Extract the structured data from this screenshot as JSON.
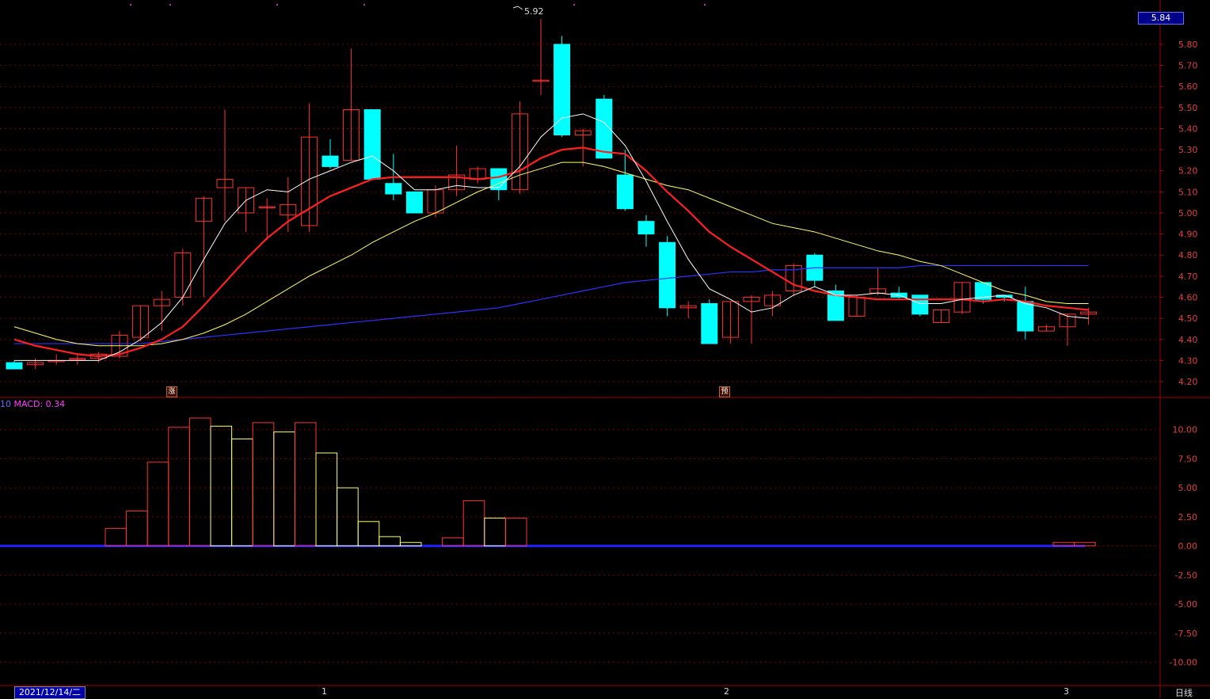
{
  "window": {
    "period": "日线",
    "date": "2021/12/14/二"
  },
  "price_panel": {
    "current_price": "5.84",
    "peak_label": "5.92",
    "axis_ticks": [
      "5.80",
      "5.70",
      "5.60",
      "5.50",
      "5.40",
      "5.30",
      "5.20",
      "5.10",
      "5.00",
      "4.90",
      "4.80",
      "4.70",
      "4.60",
      "4.50",
      "4.40",
      "4.30",
      "4.20"
    ],
    "tags": [
      "涨",
      "预"
    ]
  },
  "macd_panel": {
    "prefix": "10",
    "name": "MACD: 0.34",
    "axis_ticks": [
      "10.00",
      "7.50",
      "5.00",
      "2.50",
      "0.00",
      "-2.50",
      "-5.00",
      "-7.50",
      "-10.00"
    ]
  },
  "x_axis": {
    "months": [
      "1",
      "2",
      "3"
    ]
  },
  "colors": {
    "up": "#ff3232",
    "down": "#00ffff",
    "ma5": "#ffffff",
    "ma10": "#ff2020",
    "ma20": "#ffff60",
    "ma60": "#3030ff",
    "grid": "#800000"
  },
  "chart_data": {
    "type": "candlestick",
    "ohlc": [
      [
        4.29,
        4.3,
        4.26,
        4.26
      ],
      [
        4.28,
        4.31,
        4.26,
        4.29
      ],
      [
        4.3,
        4.33,
        4.28,
        4.3
      ],
      [
        4.31,
        4.33,
        4.28,
        4.31
      ],
      [
        4.31,
        4.34,
        4.29,
        4.33
      ],
      [
        4.32,
        4.44,
        4.31,
        4.42
      ],
      [
        4.41,
        4.56,
        4.39,
        4.56
      ],
      [
        4.56,
        4.63,
        4.44,
        4.59
      ],
      [
        4.6,
        4.83,
        4.56,
        4.81
      ],
      [
        4.96,
        5.08,
        4.6,
        5.07
      ],
      [
        5.12,
        5.49,
        4.96,
        5.16
      ],
      [
        5.0,
        5.12,
        4.91,
        5.12
      ],
      [
        5.03,
        5.07,
        4.87,
        5.03
      ],
      [
        4.99,
        5.17,
        4.91,
        5.04
      ],
      [
        4.94,
        5.52,
        4.91,
        5.36
      ],
      [
        5.27,
        5.35,
        5.21,
        5.22
      ],
      [
        5.25,
        5.78,
        5.25,
        5.49
      ],
      [
        5.49,
        5.49,
        5.16,
        5.16
      ],
      [
        5.14,
        5.28,
        5.06,
        5.09
      ],
      [
        5.1,
        5.1,
        5.0,
        5.0
      ],
      [
        5.0,
        5.13,
        4.98,
        5.11
      ],
      [
        5.11,
        5.32,
        5.08,
        5.18
      ],
      [
        5.16,
        5.22,
        5.14,
        5.21
      ],
      [
        5.21,
        5.21,
        5.06,
        5.11
      ],
      [
        5.11,
        5.53,
        5.09,
        5.47
      ],
      [
        5.63,
        5.92,
        5.56,
        5.63
      ],
      [
        5.8,
        5.84,
        5.36,
        5.37
      ],
      [
        5.37,
        5.4,
        5.22,
        5.39
      ],
      [
        5.54,
        5.56,
        5.26,
        5.26
      ],
      [
        5.18,
        5.3,
        5.01,
        5.02
      ],
      [
        4.96,
        4.99,
        4.84,
        4.9
      ],
      [
        4.86,
        4.89,
        4.51,
        4.55
      ],
      [
        4.55,
        4.58,
        4.5,
        4.56
      ],
      [
        4.57,
        4.59,
        4.38,
        4.38
      ],
      [
        4.41,
        4.58,
        4.38,
        4.58
      ],
      [
        4.58,
        4.61,
        4.38,
        4.6
      ],
      [
        4.56,
        4.63,
        4.51,
        4.61
      ],
      [
        4.63,
        4.76,
        4.61,
        4.75
      ],
      [
        4.8,
        4.81,
        4.65,
        4.68
      ],
      [
        4.63,
        4.66,
        4.49,
        4.49
      ],
      [
        4.51,
        4.61,
        4.51,
        4.6
      ],
      [
        4.62,
        4.74,
        4.61,
        4.64
      ],
      [
        4.62,
        4.65,
        4.59,
        4.6
      ],
      [
        4.61,
        4.61,
        4.51,
        4.52
      ],
      [
        4.48,
        4.54,
        4.48,
        4.54
      ],
      [
        4.53,
        4.67,
        4.52,
        4.67
      ],
      [
        4.67,
        4.67,
        4.57,
        4.59
      ],
      [
        4.61,
        4.61,
        4.58,
        4.6
      ],
      [
        4.58,
        4.65,
        4.4,
        4.44
      ],
      [
        4.44,
        4.47,
        4.44,
        4.46
      ],
      [
        4.46,
        4.52,
        4.37,
        4.52
      ],
      [
        4.52,
        4.55,
        4.47,
        4.53
      ]
    ],
    "ma5": [
      4.3,
      4.3,
      4.3,
      4.3,
      4.3,
      4.34,
      4.4,
      4.48,
      4.6,
      4.78,
      4.95,
      5.06,
      5.11,
      5.1,
      5.16,
      5.2,
      5.24,
      5.27,
      5.2,
      5.11,
      5.11,
      5.13,
      5.12,
      5.12,
      5.22,
      5.36,
      5.45,
      5.47,
      5.43,
      5.32,
      5.15,
      4.96,
      4.78,
      4.64,
      4.59,
      4.53,
      4.55,
      4.61,
      4.65,
      4.61,
      4.61,
      4.62,
      4.61,
      4.57,
      4.57,
      4.59,
      4.6,
      4.61,
      4.57,
      4.55,
      4.51,
      4.5
    ],
    "ma10": [
      4.4,
      4.37,
      4.35,
      4.33,
      4.32,
      4.33,
      4.36,
      4.4,
      4.46,
      4.56,
      4.67,
      4.78,
      4.88,
      4.96,
      5.02,
      5.08,
      5.12,
      5.16,
      5.17,
      5.17,
      5.17,
      5.17,
      5.16,
      5.17,
      5.2,
      5.26,
      5.3,
      5.31,
      5.29,
      5.28,
      5.2,
      5.1,
      5.01,
      4.91,
      4.84,
      4.78,
      4.72,
      4.66,
      4.63,
      4.61,
      4.6,
      4.59,
      4.59,
      4.59,
      4.59,
      4.59,
      4.58,
      4.59,
      4.58,
      4.56,
      4.55,
      4.54
    ],
    "ma20": [
      4.46,
      4.43,
      4.4,
      4.38,
      4.37,
      4.37,
      4.37,
      4.38,
      4.4,
      4.43,
      4.47,
      4.52,
      4.58,
      4.64,
      4.7,
      4.75,
      4.8,
      4.86,
      4.91,
      4.96,
      5.0,
      5.05,
      5.1,
      5.14,
      5.18,
      5.21,
      5.24,
      5.24,
      5.22,
      5.19,
      5.16,
      5.13,
      5.11,
      5.07,
      5.03,
      4.99,
      4.95,
      4.93,
      4.91,
      4.88,
      4.85,
      4.82,
      4.8,
      4.77,
      4.75,
      4.71,
      4.67,
      4.63,
      4.61,
      4.58,
      4.57,
      4.57
    ],
    "ma60": [
      4.38,
      4.38,
      4.38,
      4.38,
      4.38,
      4.38,
      4.38,
      4.39,
      4.4,
      4.41,
      4.42,
      4.43,
      4.44,
      4.45,
      4.46,
      4.47,
      4.48,
      4.49,
      4.5,
      4.51,
      4.52,
      4.53,
      4.54,
      4.55,
      4.57,
      4.59,
      4.61,
      4.63,
      4.65,
      4.67,
      4.68,
      4.69,
      4.7,
      4.71,
      4.72,
      4.72,
      4.73,
      4.73,
      4.74,
      4.74,
      4.74,
      4.74,
      4.74,
      4.75,
      4.75,
      4.75,
      4.75,
      4.75,
      4.75,
      4.75,
      4.75,
      4.75
    ],
    "macd_hist": [
      0,
      0,
      0,
      0,
      0,
      1.5,
      3.0,
      7.2,
      10.2,
      11.0,
      10.3,
      9.2,
      10.6,
      9.8,
      10.6,
      8.0,
      5.0,
      2.1,
      0.8,
      0.3,
      0,
      0.7,
      3.9,
      2.4,
      2.4,
      0,
      0,
      0,
      0,
      0,
      0,
      0,
      0,
      0,
      0,
      0,
      0,
      0,
      0,
      0,
      0,
      0,
      0,
      0,
      0,
      0,
      0,
      0,
      0,
      0,
      0.3,
      0.3
    ],
    "price_ylim": [
      4.17,
      5.86
    ],
    "macd_ylim": [
      -12,
      12.5
    ]
  }
}
